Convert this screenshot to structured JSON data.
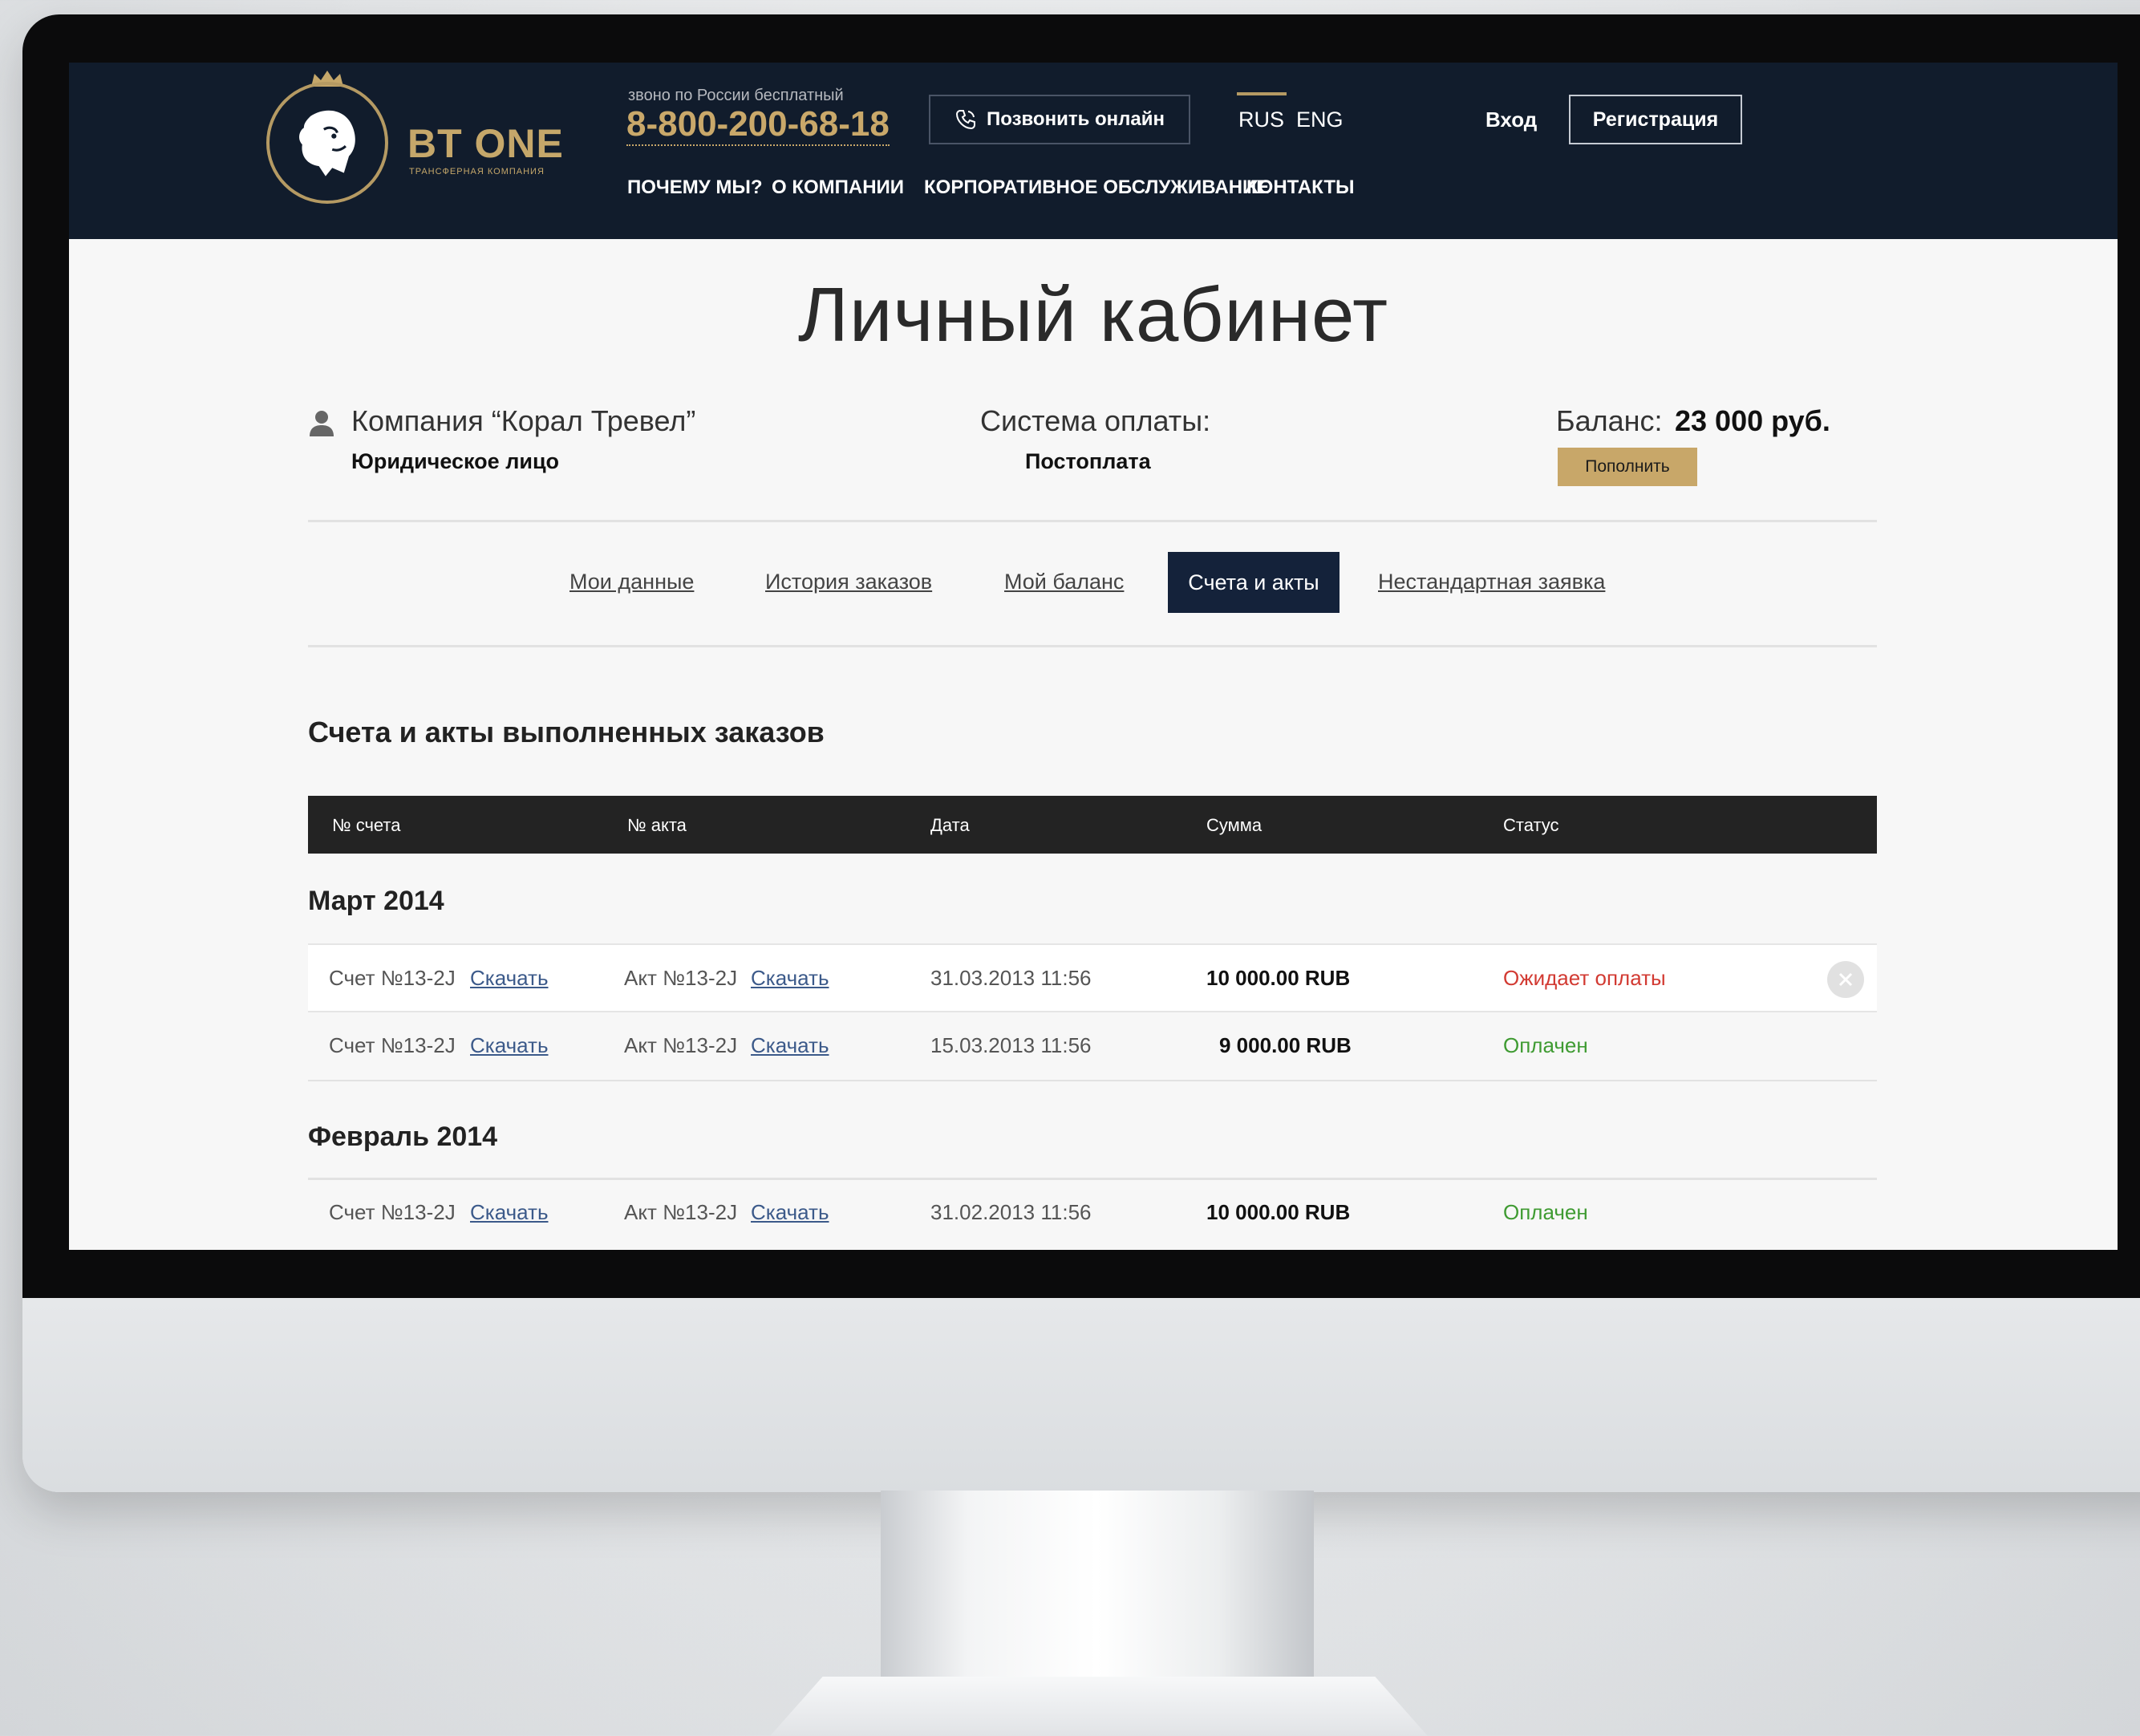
{
  "header": {
    "logo_title": "BT ONE",
    "logo_subtitle": "трансферная компания",
    "phone_note": "звоно по России бесплатный",
    "phone": "8-800-200-68-18",
    "call_button": "Позвонить онлайн",
    "lang_rus": "RUS",
    "lang_eng": "ENG",
    "login": "Вход",
    "register": "Регистрация",
    "nav": [
      "ПОЧЕМУ МЫ?",
      "О КОМПАНИИ",
      "КОРПОРАТИВНОЕ ОБСЛУЖИВАНИЕ",
      "КОНТАКТЫ"
    ]
  },
  "page_title": "Личный кабинет",
  "account": {
    "company": "Компания “Корал Тревел”",
    "type": "Юридическое лицо",
    "payment_label": "Система оплаты:",
    "payment_value": "Постоплата",
    "balance_label": "Баланс:",
    "balance_value": "23 000 руб.",
    "topup_button": "Пополнить"
  },
  "tabs": [
    "Мои данные",
    "История заказов",
    "Мой баланс",
    "Счета и акты",
    "Нестандартная заявка"
  ],
  "active_tab": "Счета и акты",
  "section_title": "Счета и акты выполненных заказов",
  "table": {
    "columns": [
      "№ счета",
      "№ акта",
      "Дата",
      "Сумма",
      "Статус"
    ],
    "groups": [
      {
        "month": "Март 2014",
        "rows": [
          {
            "invoice": "Счет №13-2J",
            "invoice_link": "Скачать",
            "act": "Акт №13-2J",
            "act_link": "Скачать",
            "date": "31.03.2013 11:56",
            "sum": "10 000.00 RUB",
            "status": "Ожидает оплаты"
          },
          {
            "invoice": "Счет №13-2J",
            "invoice_link": "Скачать",
            "act": "Акт №13-2J",
            "act_link": "Скачать",
            "date": "15.03.2013 11:56",
            "sum": "9 000.00 RUB",
            "status": "Оплачен"
          }
        ]
      },
      {
        "month": "Февраль 2014",
        "rows": [
          {
            "invoice": "Счет №13-2J",
            "invoice_link": "Скачать",
            "act": "Акт №13-2J",
            "act_link": "Скачать",
            "date": "31.02.2013 11:56",
            "sum": "10 000.00 RUB",
            "status": "Оплачен"
          }
        ]
      }
    ]
  },
  "colors": {
    "header_bg": "#111c2c",
    "accent_gold": "#c8a769",
    "active_tab_bg": "#14223a",
    "status_pending": "#d23a32",
    "status_paid": "#3f9b32"
  }
}
